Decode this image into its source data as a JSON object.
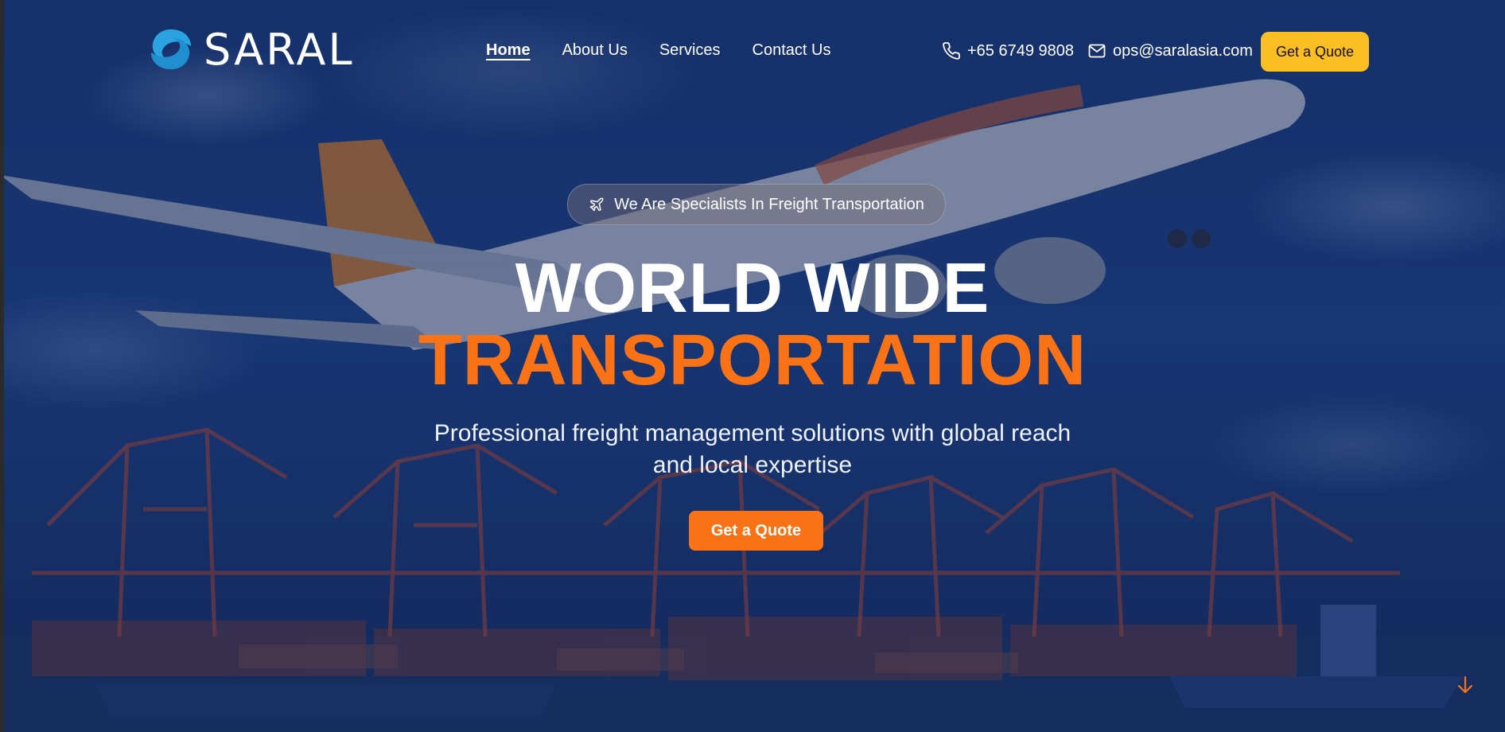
{
  "brand": {
    "name": "SARAL",
    "logo_icon": "swirl-logo-icon",
    "logo_color": "#2aa3e0"
  },
  "nav": {
    "links": [
      {
        "label": "Home",
        "active": true
      },
      {
        "label": "About Us",
        "active": false
      },
      {
        "label": "Services",
        "active": false
      },
      {
        "label": "Contact Us",
        "active": false
      }
    ]
  },
  "contact": {
    "phone": "+65 6749 9808",
    "phone_icon": "phone-icon",
    "email": "ops@saralasia.com",
    "email_icon": "mail-icon"
  },
  "header_cta": {
    "label": "Get a Quote",
    "color": "#fbbf24"
  },
  "hero": {
    "badge": {
      "icon": "plane-icon",
      "text": "We Are Specialists In Freight Transportation"
    },
    "title_line1": "WORLD WIDE",
    "title_line2": "TRANSPORTATION",
    "subtitle_line1": "Professional freight management solutions with global reach",
    "subtitle_line2": "and local expertise",
    "cta": {
      "label": "Get a Quote",
      "color": "#f97316"
    },
    "scroll_icon": "arrow-down-icon",
    "background": "airplane-over-port-cranes-image"
  },
  "colors": {
    "accent_orange": "#f97316",
    "accent_yellow": "#fbbf24",
    "overlay_blue": "#1d3f82"
  }
}
